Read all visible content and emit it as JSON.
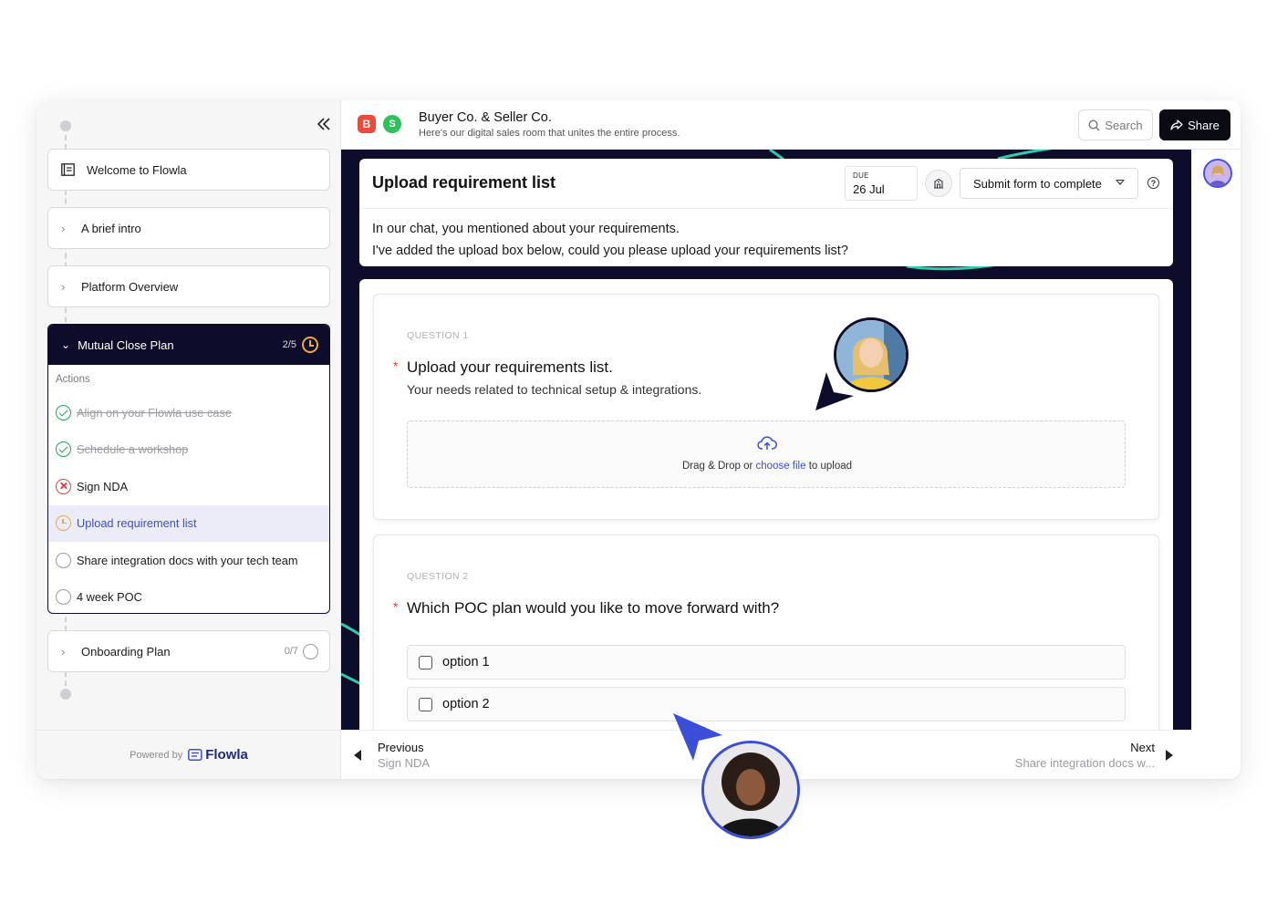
{
  "sidebar": {
    "welcome_label": "Welcome to Flowla",
    "intro_label": "A brief intro",
    "overview_label": "Platform Overview",
    "mutual_plan": {
      "label": "Mutual Close Plan",
      "count": "2/5",
      "actions_label": "Actions",
      "items": [
        {
          "label": "Align on your Flowla use case",
          "status": "done"
        },
        {
          "label": "Schedule a workshop",
          "status": "done"
        },
        {
          "label": "Sign NDA",
          "status": "blocked"
        },
        {
          "label": "Upload requirement list",
          "status": "in-progress"
        },
        {
          "label": "Share integration docs with your tech team",
          "status": "todo"
        },
        {
          "label": "4 week POC",
          "status": "todo"
        }
      ]
    },
    "onboarding": {
      "label": "Onboarding Plan",
      "count": "0/7"
    },
    "powered_by": "Powered by",
    "brand": "Flowla"
  },
  "header": {
    "logo_b": "B",
    "logo_s": "S",
    "title": "Buyer Co. & Seller Co.",
    "subtitle": "Here's our digital sales room that unites the entire process.",
    "search_label": "Search",
    "share_label": "Share"
  },
  "task": {
    "title": "Upload requirement list",
    "due_label": "DUE",
    "due_date": "26 Jul",
    "submit_label": "Submit form to complete",
    "description_line1": "In our chat, you mentioned about your requirements.",
    "description_line2": "I've added the upload box below, could you please upload your requirements list?"
  },
  "form": {
    "q1": {
      "label": "QUESTION 1",
      "title": "Upload your requirements list.",
      "hint": "Your needs related to technical setup & integrations.",
      "dz_prefix": "Drag & Drop or ",
      "dz_link": "choose file",
      "dz_suffix": " to upload"
    },
    "q2": {
      "label": "QUESTION 2",
      "title": "Which POC plan would you like to move forward with?",
      "options": [
        "option 1",
        "option 2"
      ]
    }
  },
  "nav": {
    "prev_label": "Previous",
    "prev_sub": "Sign NDA",
    "next_label": "Next",
    "next_sub": "Share integration docs w..."
  },
  "colors": {
    "canvas": "#0d0d2b",
    "accent": "#3b4ed8",
    "done": "#21a35a",
    "blocked": "#e0413c",
    "in_progress": "#f0a92c",
    "deco_line": "#2ee6b8"
  }
}
